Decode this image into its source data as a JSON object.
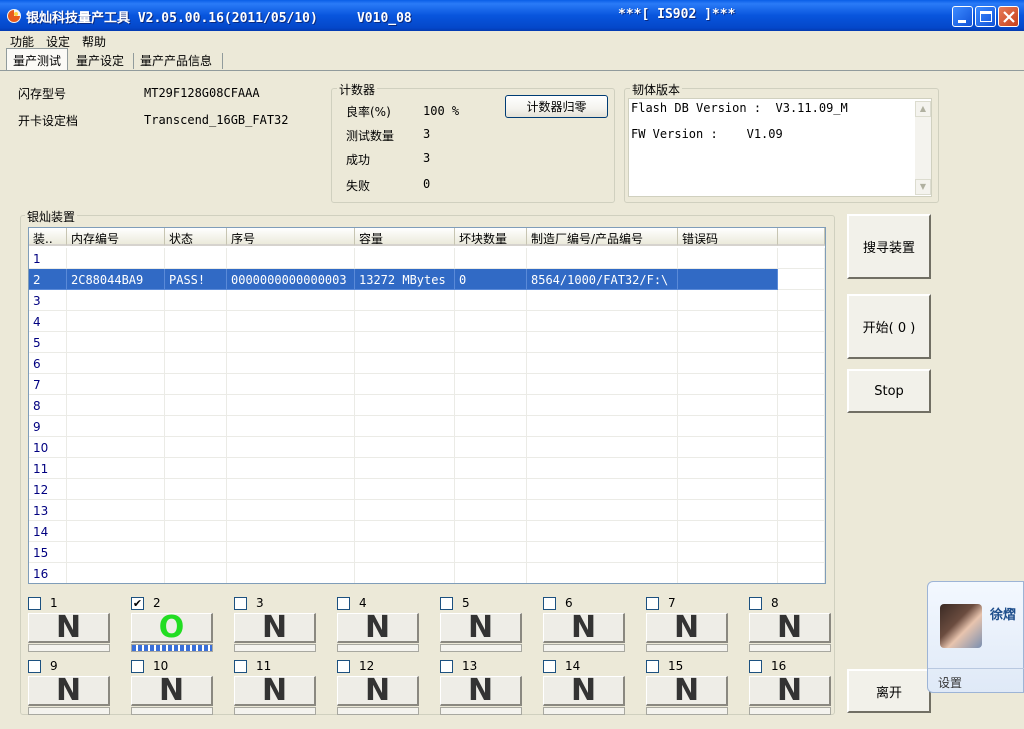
{
  "window": {
    "title": "银灿科技量产工具 V2.05.00.16(2011/05/10)     V010_08",
    "title_center": "***[ IS902 ]***"
  },
  "menu": [
    "功能",
    "设定",
    "帮助"
  ],
  "tabs": [
    "量产测试",
    "量产设定",
    "量产产品信息"
  ],
  "flash": {
    "label_type": "闪存型号",
    "type_value": "MT29F128G08CFAAA",
    "label_setting": "开卡设定档",
    "setting_value": "Transcend_16GB_FAT32"
  },
  "counter": {
    "title": "计数器",
    "reset_label": "计数器归零",
    "rows": [
      {
        "label": "良率(%)",
        "value": "100 %"
      },
      {
        "label": "测试数量",
        "value": "3"
      },
      {
        "label": "成功",
        "value": "3"
      },
      {
        "label": "失败",
        "value": "0"
      }
    ]
  },
  "firmware": {
    "title": "韧体版本",
    "line1": "Flash DB Version :  V3.11.09_M",
    "line2": "FW Version :    V1.09"
  },
  "devices": {
    "title": "银灿装置",
    "headers": [
      "装..",
      "内存编号",
      "状态",
      "序号",
      "容量",
      "坏块数量",
      "制造厂编号/产品编号",
      "错误码"
    ],
    "rows": [
      {
        "idx": "1"
      },
      {
        "idx": "2",
        "mem": "2C88044BA9",
        "status": "PASS!",
        "serial": "0000000000000003",
        "cap": "13272 MBytes",
        "bad": "0",
        "vidpid": "8564/1000/FAT32/F:\\",
        "err": ""
      },
      {
        "idx": "3"
      },
      {
        "idx": "4"
      },
      {
        "idx": "5"
      },
      {
        "idx": "6"
      },
      {
        "idx": "7"
      },
      {
        "idx": "8"
      },
      {
        "idx": "9"
      },
      {
        "idx": "10"
      },
      {
        "idx": "11"
      },
      {
        "idx": "12"
      },
      {
        "idx": "13"
      },
      {
        "idx": "14"
      },
      {
        "idx": "15"
      },
      {
        "idx": "16"
      }
    ]
  },
  "buttons": {
    "search": "搜寻装置",
    "start": "开始( 0 )",
    "stop": "Stop",
    "exit": "离开"
  },
  "ports": [
    {
      "num": "1",
      "checked": false,
      "state": "N",
      "progress": 0
    },
    {
      "num": "2",
      "checked": true,
      "state": "O",
      "progress": 1.0
    },
    {
      "num": "3",
      "checked": false,
      "state": "N",
      "progress": 0
    },
    {
      "num": "4",
      "checked": false,
      "state": "N",
      "progress": 0
    },
    {
      "num": "5",
      "checked": false,
      "state": "N",
      "progress": 0
    },
    {
      "num": "6",
      "checked": false,
      "state": "N",
      "progress": 0
    },
    {
      "num": "7",
      "checked": false,
      "state": "N",
      "progress": 0
    },
    {
      "num": "8",
      "checked": false,
      "state": "N",
      "progress": 0
    },
    {
      "num": "9",
      "checked": false,
      "state": "N",
      "progress": 0
    },
    {
      "num": "10",
      "checked": false,
      "state": "N",
      "progress": 0
    },
    {
      "num": "11",
      "checked": false,
      "state": "N",
      "progress": 0
    },
    {
      "num": "12",
      "checked": false,
      "state": "N",
      "progress": 0
    },
    {
      "num": "13",
      "checked": false,
      "state": "N",
      "progress": 0
    },
    {
      "num": "14",
      "checked": false,
      "state": "N",
      "progress": 0
    },
    {
      "num": "15",
      "checked": false,
      "state": "N",
      "progress": 0
    },
    {
      "num": "16",
      "checked": false,
      "state": "N",
      "progress": 0
    }
  ],
  "popup": {
    "name": "徐熠",
    "settings": "设置"
  },
  "colors": {
    "titlebar": "#0855dd",
    "selection": "#316ac5",
    "ok": "#22dd22"
  }
}
